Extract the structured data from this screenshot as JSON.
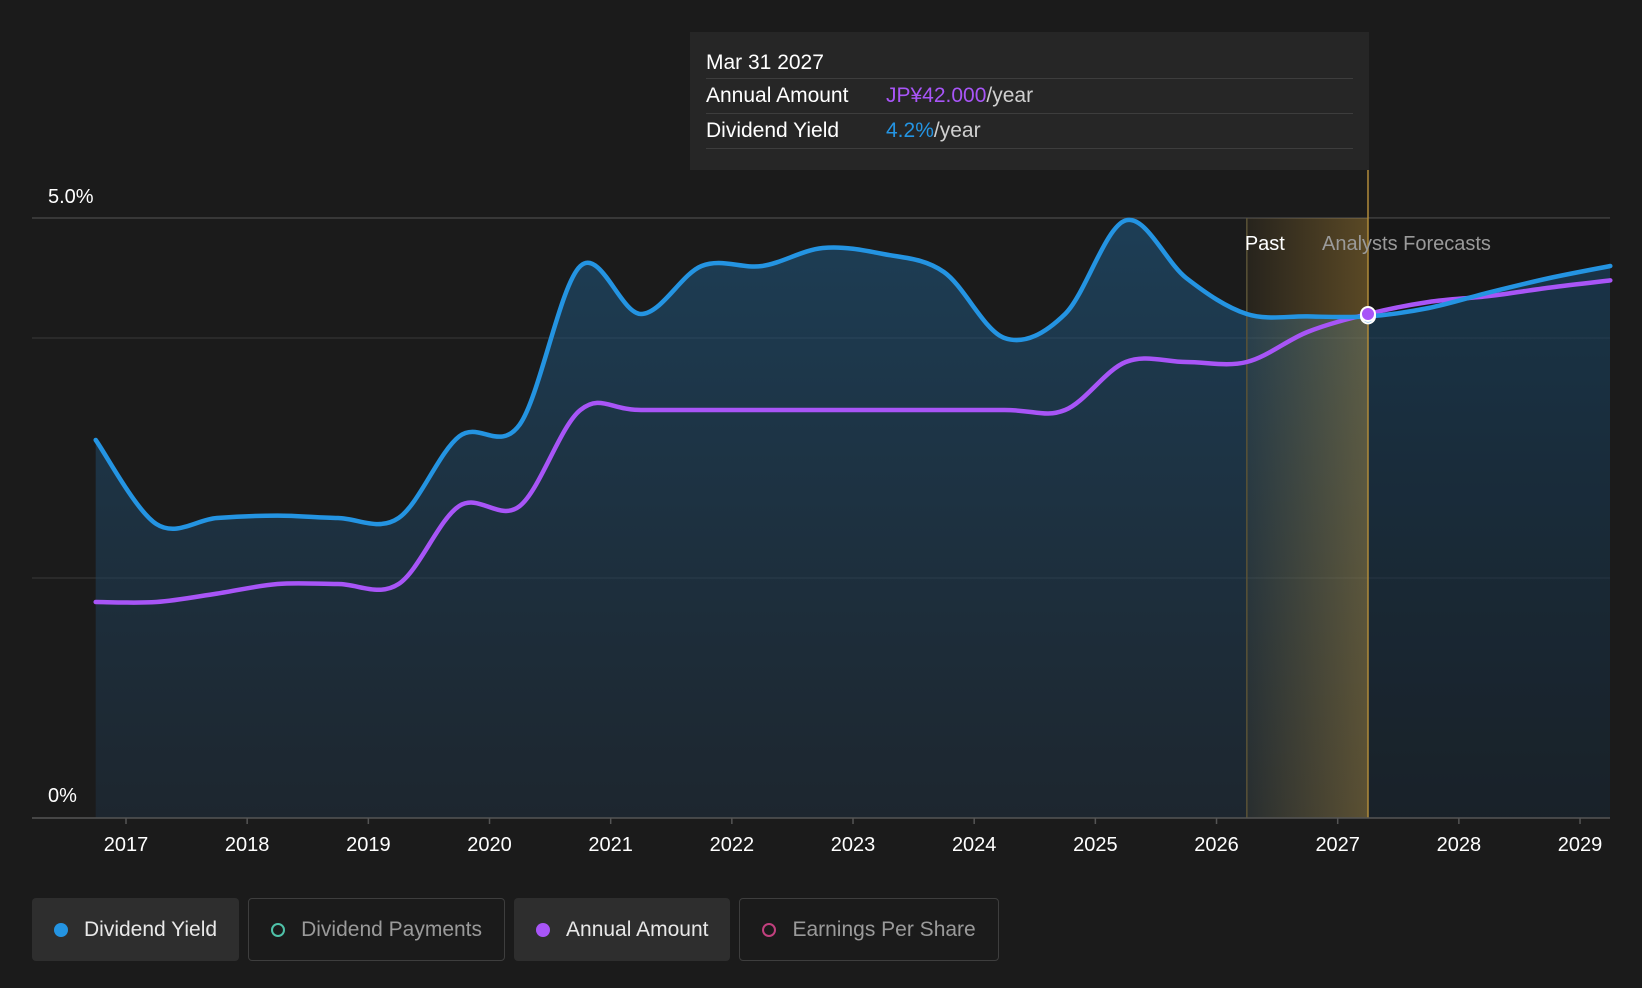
{
  "chart_data": {
    "type": "line",
    "x_ticks": [
      "2017",
      "2018",
      "2019",
      "2020",
      "2021",
      "2022",
      "2023",
      "2024",
      "2025",
      "2026",
      "2027",
      "2028",
      "2029"
    ],
    "y_tick_labels": [
      "0%",
      "5.0%"
    ],
    "ylim": [
      0,
      5.0
    ],
    "grid": true,
    "region_labels": {
      "past": "Past",
      "forecast": "Analysts Forecasts"
    },
    "past_end": 2026.25,
    "selected_x": 2027.25,
    "colors": {
      "dividend_yield": "#2494e2",
      "annual_amount": "#a855f7",
      "band": "#e0a93a"
    },
    "series": [
      {
        "name": "Dividend Yield",
        "unit": "%",
        "points": [
          [
            2016.75,
            3.15
          ],
          [
            2017.25,
            2.45
          ],
          [
            2017.75,
            2.5
          ],
          [
            2018.25,
            2.52
          ],
          [
            2018.75,
            2.5
          ],
          [
            2019.25,
            2.5
          ],
          [
            2019.75,
            3.18
          ],
          [
            2020.25,
            3.28
          ],
          [
            2020.75,
            4.6
          ],
          [
            2021.25,
            4.2
          ],
          [
            2021.75,
            4.6
          ],
          [
            2022.25,
            4.6
          ],
          [
            2022.75,
            4.75
          ],
          [
            2023.25,
            4.7
          ],
          [
            2023.75,
            4.55
          ],
          [
            2024.25,
            4.0
          ],
          [
            2024.75,
            4.2
          ],
          [
            2025.25,
            4.98
          ],
          [
            2025.75,
            4.5
          ],
          [
            2026.25,
            4.2
          ],
          [
            2026.75,
            4.18
          ],
          [
            2027.25,
            4.18
          ],
          [
            2027.75,
            4.25
          ],
          [
            2028.25,
            4.38
          ],
          [
            2028.75,
            4.5
          ],
          [
            2029.25,
            4.6
          ]
        ]
      },
      {
        "name": "Annual Amount",
        "unit": "JP¥",
        "points": [
          [
            2016.75,
            18.0
          ],
          [
            2017.25,
            18.0
          ],
          [
            2017.75,
            18.7
          ],
          [
            2018.25,
            19.5
          ],
          [
            2018.75,
            19.5
          ],
          [
            2019.25,
            19.5
          ],
          [
            2019.75,
            26.0
          ],
          [
            2020.25,
            26.0
          ],
          [
            2020.75,
            34.0
          ],
          [
            2021.25,
            34.0
          ],
          [
            2022.25,
            34.0
          ],
          [
            2023.25,
            34.0
          ],
          [
            2024.25,
            34.0
          ],
          [
            2024.75,
            34.0
          ],
          [
            2025.25,
            38.0
          ],
          [
            2025.75,
            38.0
          ],
          [
            2026.25,
            38.0
          ],
          [
            2026.75,
            40.5
          ],
          [
            2027.25,
            42.0
          ],
          [
            2027.75,
            43.0
          ],
          [
            2028.25,
            43.5
          ],
          [
            2028.75,
            44.2
          ],
          [
            2029.25,
            44.8
          ]
        ]
      }
    ]
  },
  "tooltip": {
    "date": "Mar 31 2027",
    "annual_amount_label": "Annual Amount",
    "annual_amount_value": "JP¥42.000",
    "annual_amount_unit": "/year",
    "dividend_yield_label": "Dividend Yield",
    "dividend_yield_value": "4.2%",
    "dividend_yield_unit": "/year"
  },
  "legend": {
    "items": [
      {
        "label": "Dividend Yield",
        "active": true,
        "color": "#2494e2"
      },
      {
        "label": "Dividend Payments",
        "active": false,
        "color": "#4fc1a8"
      },
      {
        "label": "Annual Amount",
        "active": true,
        "color": "#a855f7"
      },
      {
        "label": "Earnings Per Share",
        "active": false,
        "color": "#c1407e"
      }
    ]
  }
}
